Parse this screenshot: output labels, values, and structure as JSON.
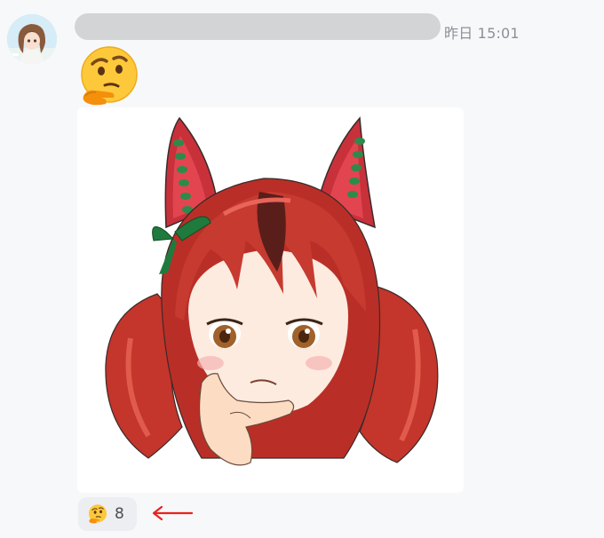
{
  "message": {
    "timestamp": "昨日 15:01",
    "emoji": "thinking-face",
    "image_description_icon": "anime-girl-thinking-sticker"
  },
  "reaction": {
    "emoji": "thinking-face",
    "count": "8"
  },
  "annotation": {
    "icon": "red-arrow-left",
    "color": "#e8231d"
  },
  "colors": {
    "background": "#f7f8fa",
    "pill": "#eceef1",
    "timestamp": "#8c9096",
    "redacted_bar": "#d3d4d6"
  }
}
